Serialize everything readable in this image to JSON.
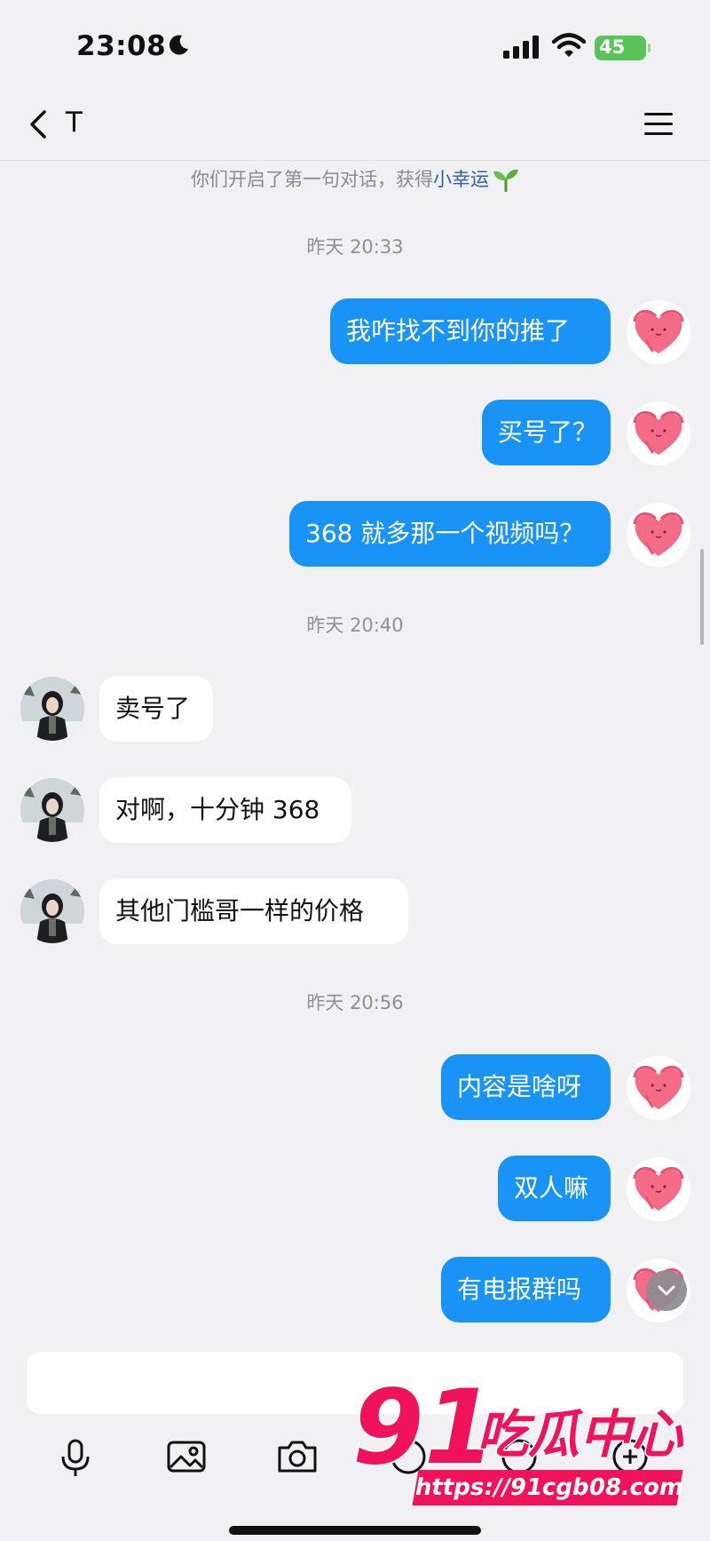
{
  "status": {
    "time": "23:08",
    "battery": "45"
  },
  "header": {
    "title": "T"
  },
  "system_note": {
    "text": "你们开启了第一句对话，获得",
    "link": "小幸运"
  },
  "conversation": {
    "ts1": "昨天 20:33",
    "m1": "我咋找不到你的推了",
    "m2": "买号了？",
    "m3": "368 就多那一个视频吗？",
    "ts2": "昨天 20:40",
    "m4": "卖号了",
    "m5": "对啊，十分钟 368",
    "m6": "其他门槛哥一样的价格",
    "ts3": "昨天 20:56",
    "m7": "内容是啥呀",
    "m8": "双人嘛",
    "m9": "有电报群吗"
  },
  "watermark": {
    "brand": "91吃瓜中心",
    "url": "https://91cgb08.com"
  },
  "colors": {
    "outgoing_bubble": "#1a93f6",
    "incoming_bubble": "#ffffff",
    "background": "#f1f1f3",
    "watermark": "#f0125b"
  }
}
